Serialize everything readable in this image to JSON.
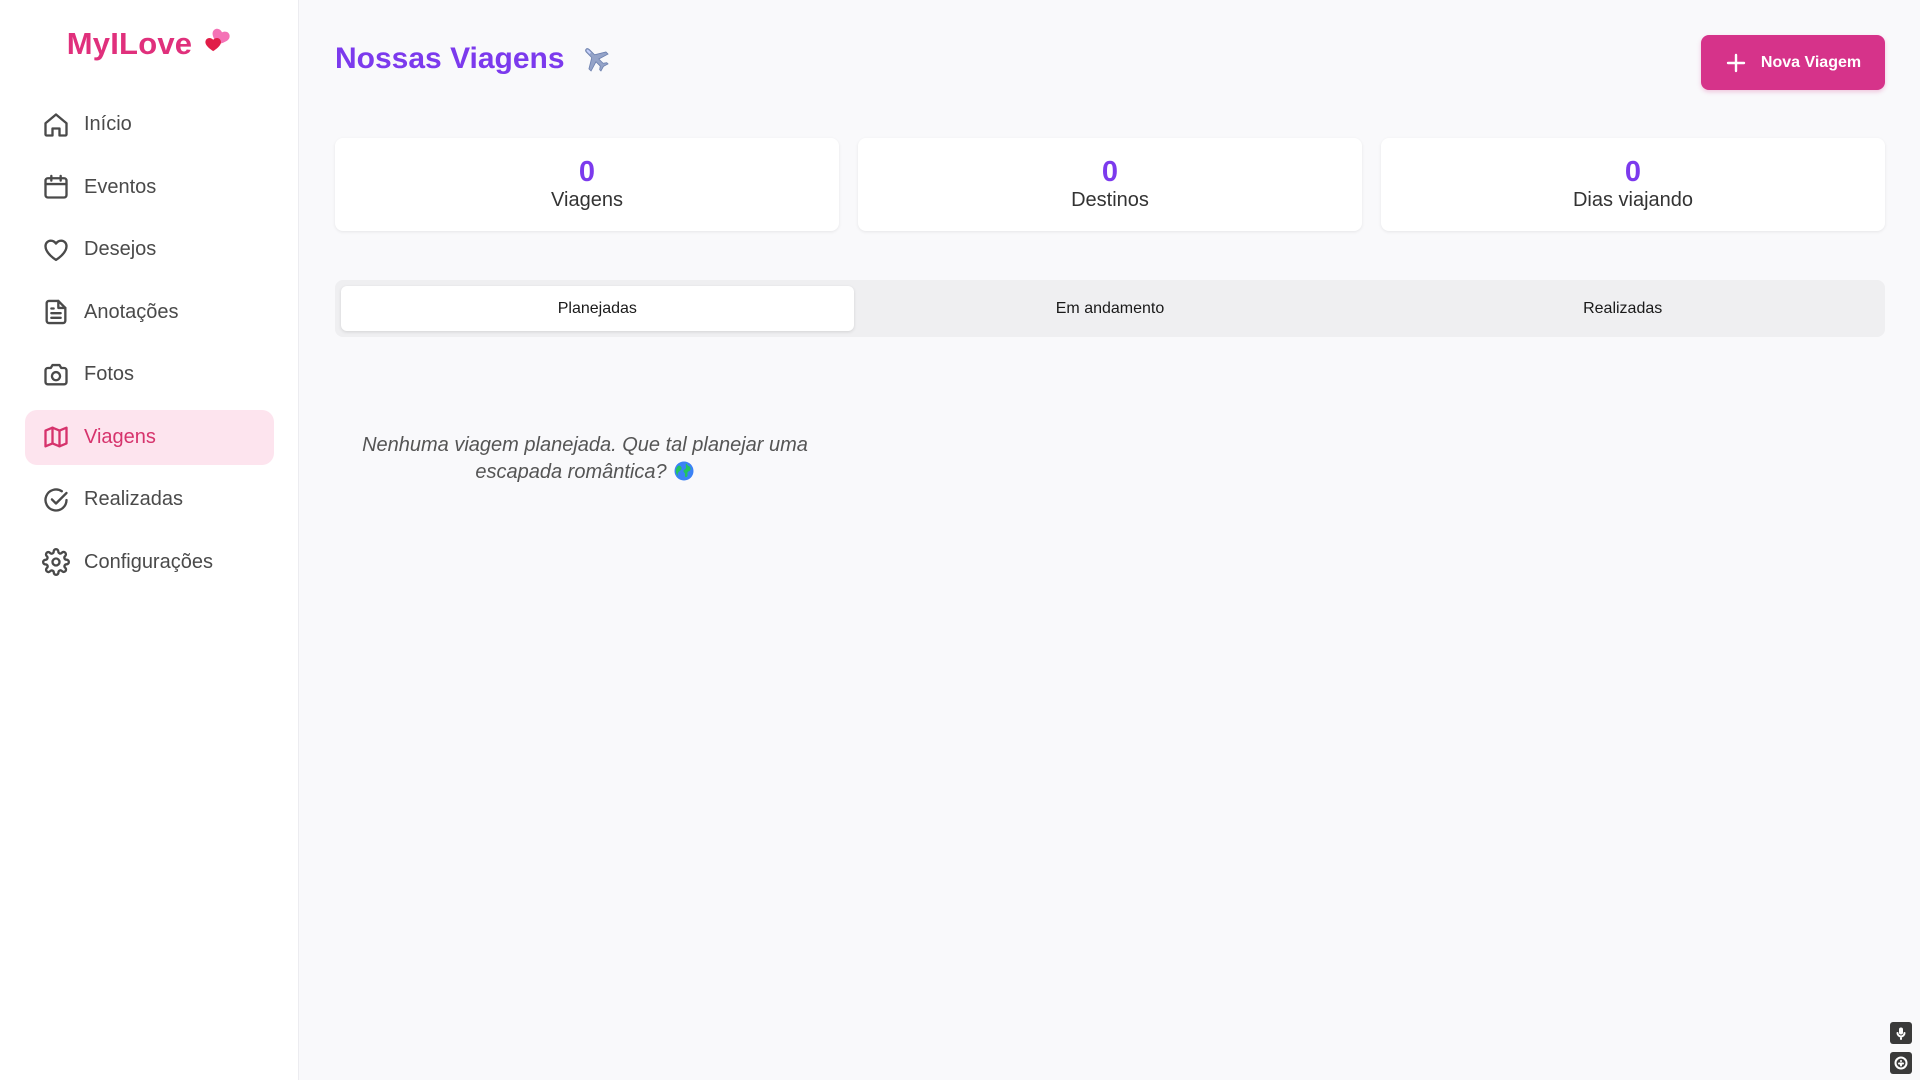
{
  "app": {
    "logo_text": "MyILove"
  },
  "sidebar": {
    "items": [
      {
        "label": "Início",
        "icon": "home-icon"
      },
      {
        "label": "Eventos",
        "icon": "calendar-icon"
      },
      {
        "label": "Desejos",
        "icon": "heart-icon"
      },
      {
        "label": "Anotações",
        "icon": "file-text-icon"
      },
      {
        "label": "Fotos",
        "icon": "camera-icon"
      },
      {
        "label": "Viagens",
        "icon": "map-icon",
        "active": true
      },
      {
        "label": "Realizadas",
        "icon": "check-circle-icon"
      },
      {
        "label": "Configurações",
        "icon": "gear-icon"
      }
    ]
  },
  "header": {
    "title": "Nossas Viagens",
    "title_emoji": "airplane-icon",
    "new_button_label": "Nova Viagem"
  },
  "stats": [
    {
      "value": "0",
      "label": "Viagens"
    },
    {
      "value": "0",
      "label": "Destinos"
    },
    {
      "value": "0",
      "label": "Dias viajando"
    }
  ],
  "tabs": [
    {
      "label": "Planejadas",
      "active": true
    },
    {
      "label": "Em andamento"
    },
    {
      "label": "Realizadas"
    }
  ],
  "empty_state": {
    "message": "Nenhuma viagem planejada. Que tal planejar uma escapada romântica?",
    "emoji": "globe-icon"
  },
  "colors": {
    "brand_pink": "#e0307c",
    "accent_purple": "#7c3aed",
    "button_pink": "#d6338a",
    "active_nav_bg": "#fde4ee"
  }
}
